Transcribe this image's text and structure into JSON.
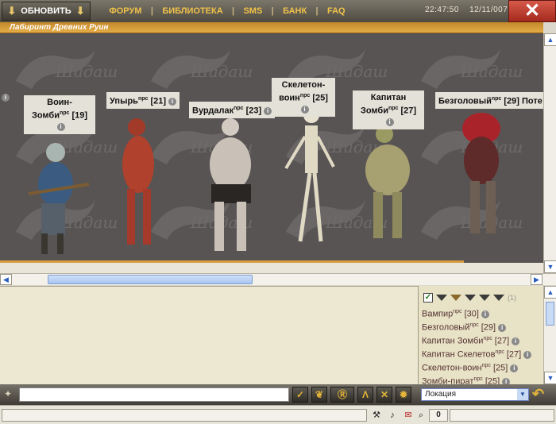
{
  "header": {
    "refresh_label": "ОБНОВИТЬ",
    "menu": [
      "ФОРУМ",
      "БИБЛИОТЕКА",
      "SMS",
      "БАНК",
      "FAQ"
    ],
    "menu_sep": "|",
    "time": "22:47:50",
    "date": "12/11/007",
    "close_glyph": "✕"
  },
  "location": {
    "title": "Лабиринт Древних Руин"
  },
  "monsters": [
    {
      "name1": "Воин-",
      "name2": "Зомби",
      "tag": "npc",
      "level": "[19]"
    },
    {
      "name1": "Упырь",
      "tag": "npc",
      "level": "[21]"
    },
    {
      "name1": "Вурдалак",
      "tag": "npc",
      "level": "[23]"
    },
    {
      "name1": "Скелетон-",
      "name2": "воин",
      "tag": "npc",
      "level": "[25]"
    },
    {
      "name1": "Капитан",
      "name2": "Зомби",
      "tag": "npc",
      "level": "[27]"
    },
    {
      "name1": "Безголовый",
      "tag": "npc",
      "level": "[29]",
      "extra": "Поте"
    }
  ],
  "side_panel": {
    "count": "(1)",
    "list": [
      {
        "name": "Вампир",
        "tag": "npc",
        "level": "[30]"
      },
      {
        "name": "Безголовый",
        "tag": "npc",
        "level": "[29]"
      },
      {
        "name": "Капитан Зомби",
        "tag": "npc",
        "level": "[27]"
      },
      {
        "name": "Капитан Скелетов",
        "tag": "npc",
        "level": "[27]"
      },
      {
        "name": "Скелетон-воин",
        "tag": "npc",
        "level": "[25]"
      },
      {
        "name": "Зомби-пират",
        "tag": "npc",
        "level": "[25]"
      }
    ]
  },
  "bottom": {
    "tools": [
      "✓",
      "❦",
      "Ⓡ",
      "Λ",
      "✕",
      "✹"
    ],
    "select_value": "Локация"
  },
  "status": {
    "counter": "0"
  },
  "colors": {
    "menu": "#f0c24a",
    "loc_bar": "#d79b40",
    "close": "#c0392b"
  }
}
